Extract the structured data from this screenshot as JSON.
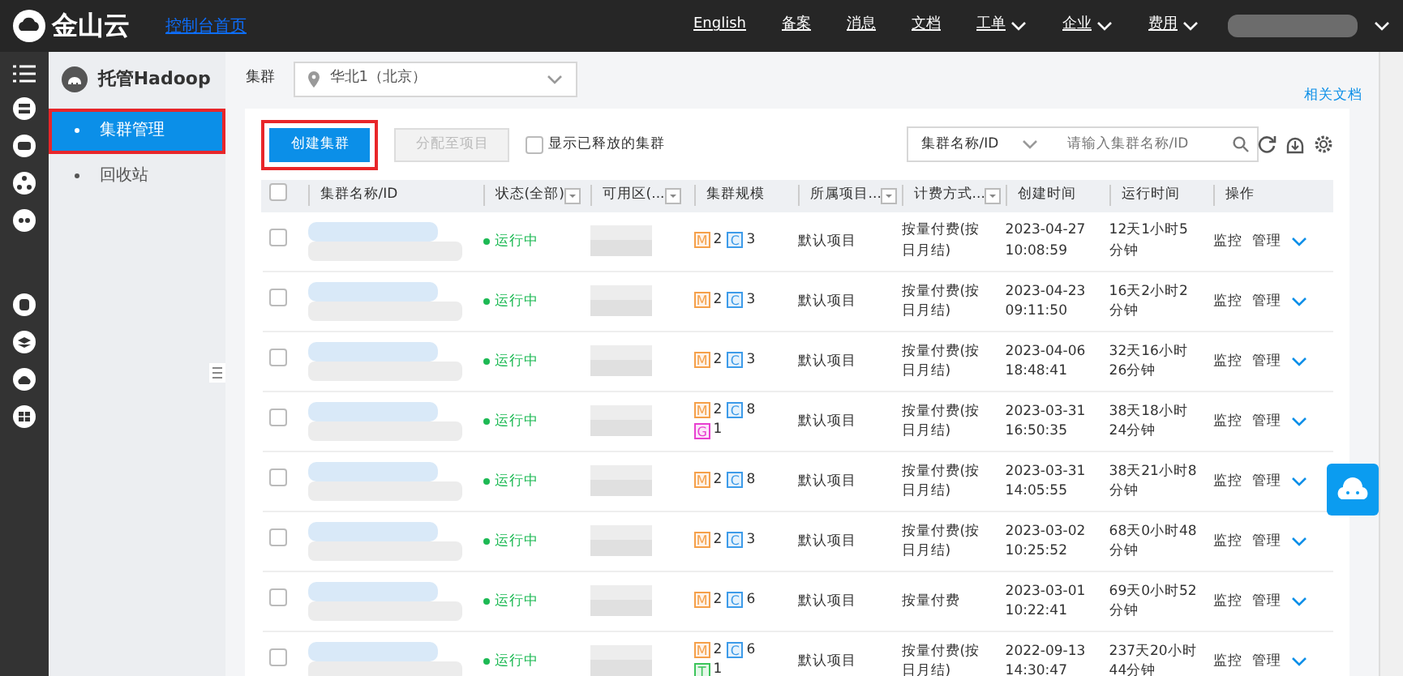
{
  "topbar": {
    "logo": "金山云",
    "home": "控制台首页",
    "nav": [
      {
        "label": "English",
        "dropdown": false
      },
      {
        "label": "备案",
        "dropdown": false
      },
      {
        "label": "消息",
        "dropdown": false
      },
      {
        "label": "文档",
        "dropdown": false
      },
      {
        "label": "工单",
        "dropdown": true
      },
      {
        "label": "企业",
        "dropdown": true
      },
      {
        "label": "费用",
        "dropdown": true
      }
    ]
  },
  "sidebar": {
    "title": "托管Hadoop",
    "items": [
      {
        "label": "集群管理",
        "selected": true,
        "highlighted": true
      },
      {
        "label": "回收站",
        "selected": false,
        "highlighted": false
      }
    ]
  },
  "region": {
    "label": "集群",
    "value": "华北1（北京）"
  },
  "docs_link": "相关文档",
  "toolbar": {
    "buttons": [
      {
        "label": "创建集群",
        "disabled": false,
        "highlighted": true
      },
      {
        "label": "分配至项目",
        "disabled": true,
        "highlighted": false
      }
    ],
    "checkbox": {
      "label": "显示已释放的集群",
      "checked": false
    },
    "search_type": "集群名称/ID",
    "search": {
      "placeholder": "请输入集群名称/ID"
    }
  },
  "table": {
    "header_checkbox": {
      "checked": false
    },
    "columns": [
      {
        "label": "集群名称/ID",
        "kind": "plain"
      },
      {
        "label": "状态(全部)",
        "kind": "filterable"
      },
      {
        "label": "可用区(...",
        "kind": "filterable"
      },
      {
        "label": "集群规模",
        "kind": "plain"
      },
      {
        "label": "所属项目...",
        "kind": "filterable"
      },
      {
        "label": "计费方式...",
        "kind": "filterable"
      },
      {
        "label": "创建时间",
        "kind": "plain"
      },
      {
        "label": "运行时间",
        "kind": "plain"
      },
      {
        "label": "操作",
        "kind": "plain"
      }
    ],
    "rows": [
      {
        "checked": false,
        "status": "运行中",
        "scale": [
          {
            "letter": "M",
            "count": "2",
            "color": "#f5a04a"
          },
          {
            "letter": "C",
            "count": "3",
            "color": "#3d9be9"
          }
        ],
        "project": "默认项目",
        "billing": "按量付费(按日月结)",
        "created": "2023-04-27 10:08:59",
        "runtime": "12天1小时5分钟",
        "actions": [
          "监控",
          "管理"
        ]
      },
      {
        "checked": false,
        "status": "运行中",
        "scale": [
          {
            "letter": "M",
            "count": "2",
            "color": "#f5a04a"
          },
          {
            "letter": "C",
            "count": "3",
            "color": "#3d9be9"
          }
        ],
        "project": "默认项目",
        "billing": "按量付费(按日月结)",
        "created": "2023-04-23 09:11:50",
        "runtime": "16天2小时2分钟",
        "actions": [
          "监控",
          "管理"
        ]
      },
      {
        "checked": false,
        "status": "运行中",
        "scale": [
          {
            "letter": "M",
            "count": "2",
            "color": "#f5a04a"
          },
          {
            "letter": "C",
            "count": "3",
            "color": "#3d9be9"
          }
        ],
        "project": "默认项目",
        "billing": "按量付费(按日月结)",
        "created": "2023-04-06 18:48:41",
        "runtime": "32天16小时26分钟",
        "actions": [
          "监控",
          "管理"
        ]
      },
      {
        "checked": false,
        "status": "运行中",
        "scale": [
          {
            "letter": "M",
            "count": "2",
            "color": "#f5a04a"
          },
          {
            "letter": "C",
            "count": "8",
            "color": "#3d9be9"
          },
          {
            "letter": "G",
            "count": "1",
            "color": "#e83fd0"
          }
        ],
        "project": "默认项目",
        "billing": "按量付费(按日月结)",
        "created": "2023-03-31 16:50:35",
        "runtime": "38天18小时24分钟",
        "actions": [
          "监控",
          "管理"
        ]
      },
      {
        "checked": false,
        "status": "运行中",
        "scale": [
          {
            "letter": "M",
            "count": "2",
            "color": "#f5a04a"
          },
          {
            "letter": "C",
            "count": "8",
            "color": "#3d9be9"
          }
        ],
        "project": "默认项目",
        "billing": "按量付费(按日月结)",
        "created": "2023-03-31 14:05:55",
        "runtime": "38天21小时8分钟",
        "actions": [
          "监控",
          "管理"
        ]
      },
      {
        "checked": false,
        "status": "运行中",
        "scale": [
          {
            "letter": "M",
            "count": "2",
            "color": "#f5a04a"
          },
          {
            "letter": "C",
            "count": "3",
            "color": "#3d9be9"
          }
        ],
        "project": "默认项目",
        "billing": "按量付费(按日月结)",
        "created": "2023-03-02 10:25:52",
        "runtime": "68天0小时48分钟",
        "actions": [
          "监控",
          "管理"
        ]
      },
      {
        "checked": false,
        "status": "运行中",
        "scale": [
          {
            "letter": "M",
            "count": "2",
            "color": "#f5a04a"
          },
          {
            "letter": "C",
            "count": "6",
            "color": "#3d9be9"
          }
        ],
        "project": "默认项目",
        "billing": "按量付费",
        "created": "2023-03-01 10:22:41",
        "runtime": "69天0小时52分钟",
        "actions": [
          "监控",
          "管理"
        ]
      },
      {
        "checked": false,
        "status": "运行中",
        "scale": [
          {
            "letter": "M",
            "count": "2",
            "color": "#f5a04a"
          },
          {
            "letter": "C",
            "count": "6",
            "color": "#3d9be9"
          },
          {
            "letter": "T",
            "count": "1",
            "color": "#3cc45a"
          }
        ],
        "project": "默认项目",
        "billing": "按量付费(按日月结)",
        "created": "2022-09-13 14:30:47",
        "runtime": "237天20小时44分钟",
        "actions": [
          "监控",
          "管理"
        ]
      }
    ]
  }
}
